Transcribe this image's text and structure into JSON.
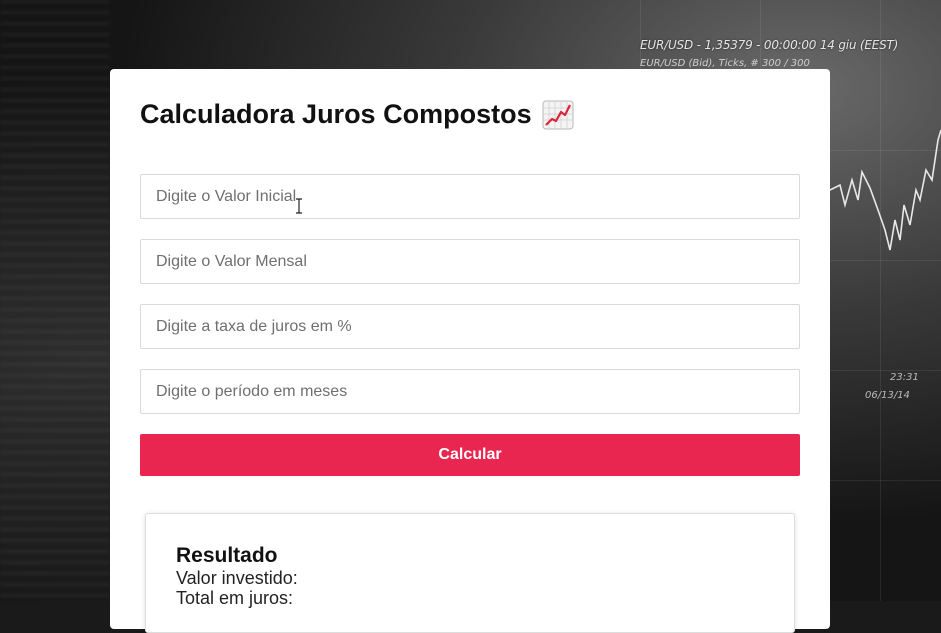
{
  "background": {
    "ticker_line": "EUR/USD - 1,35379 - 00:00:00  14 giu (EEST)",
    "ticker_sub": "EUR/USD (Bid), Ticks, # 300 / 300",
    "time_a": "23:31",
    "time_b": "06/13/14"
  },
  "app": {
    "title": "Calculadora Juros Compostos",
    "title_icon": "chart-increasing-icon"
  },
  "form": {
    "initial_value_placeholder": "Digite o Valor Inicial",
    "monthly_value_placeholder": "Digite o Valor Mensal",
    "interest_rate_placeholder": "Digite a taxa de juros em %",
    "period_placeholder": "Digite o período em meses",
    "submit_label": "Calcular"
  },
  "result": {
    "heading": "Resultado",
    "invested_label": "Valor investido:",
    "interest_label": "Total em juros:"
  },
  "colors": {
    "accent": "#e8264f",
    "card_bg": "#ffffff"
  }
}
